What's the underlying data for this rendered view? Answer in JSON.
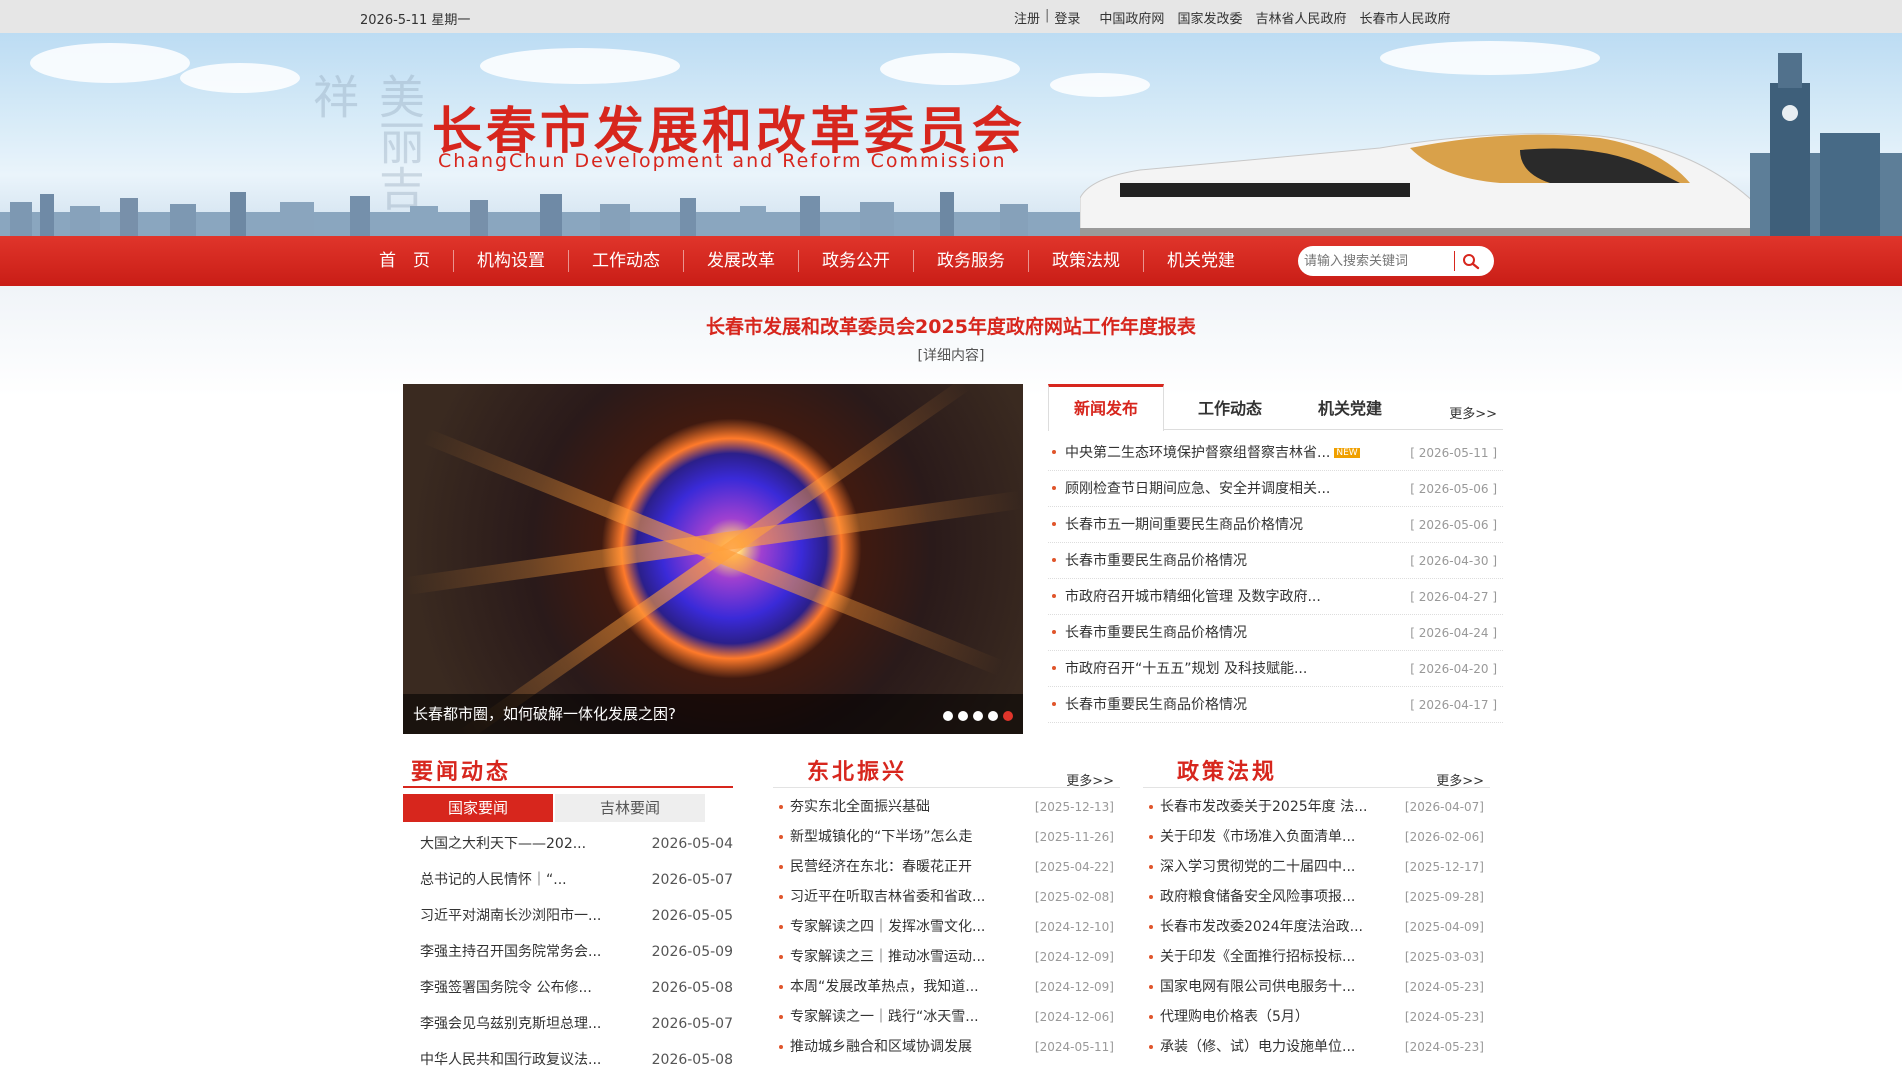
{
  "topbar": {
    "date": "2026-5-11 星期一",
    "register": "注册",
    "login": "登录",
    "links": [
      "中国政府网",
      "国家发改委",
      "吉林省人民政府",
      "长春市人民政府"
    ]
  },
  "banner": {
    "calligraphy": "美丽吉祥",
    "title": "长春市发展和改革委员会",
    "subtitle": "ChangChun Development and Reform Commission"
  },
  "nav": {
    "items": [
      "首　页",
      "机构设置",
      "工作动态",
      "发展改革",
      "政务公开",
      "政务服务",
      "政策法规",
      "机关党建"
    ],
    "search_placeholder": "请输入搜索关键词"
  },
  "notice": {
    "title": "长春市发展和改革委员会2025年度政府网站工作年度报表",
    "more": "[详细内容]"
  },
  "slide": {
    "caption": "长春都市圈，如何破解一体化发展之困?",
    "active_index": 4
  },
  "news": {
    "tabs": [
      "新闻发布",
      "工作动态",
      "机关党建"
    ],
    "more": "更多>>",
    "new_badge": "NEW",
    "items": [
      {
        "title": "中央第二生态环境保护督察组督察吉林省...",
        "date": "[ 2026-05-11 ]"
      },
      {
        "title": "顾刚检查节日期间应急、安全并调度相关...",
        "date": "[ 2026-05-06 ]"
      },
      {
        "title": "长春市五一期间重要民生商品价格情况",
        "date": "[ 2026-05-06 ]"
      },
      {
        "title": "长春市重要民生商品价格情况",
        "date": "[ 2026-04-30 ]"
      },
      {
        "title": "市政府召开城市精细化管理 及数字政府...",
        "date": "[ 2026-04-27 ]"
      },
      {
        "title": "长春市重要民生商品价格情况",
        "date": "[ 2026-04-24 ]"
      },
      {
        "title": "市政府召开“十五五”规划 及科技赋能...",
        "date": "[ 2026-04-20 ]"
      },
      {
        "title": "长春市重要民生商品价格情况",
        "date": "[ 2026-04-17 ]"
      }
    ]
  },
  "yaowen": {
    "heading": "要闻动态",
    "subtabs": [
      "国家要闻",
      "吉林要闻"
    ],
    "items": [
      {
        "title": "大国之大利天下——202...",
        "date": "2026-05-04"
      },
      {
        "title": "总书记的人民情怀｜“...",
        "date": "2026-05-07"
      },
      {
        "title": "习近平对湖南长沙浏阳市一...",
        "date": "2026-05-05"
      },
      {
        "title": "李强主持召开国务院常务会...",
        "date": "2026-05-09"
      },
      {
        "title": "李强签署国务院令 公布修...",
        "date": "2026-05-08"
      },
      {
        "title": "李强会见乌兹别克斯坦总理...",
        "date": "2026-05-07"
      },
      {
        "title": "中华人民共和国行政复议法...",
        "date": "2026-05-08"
      }
    ]
  },
  "dongbei": {
    "heading": "东北振兴",
    "more": "更多>>",
    "items": [
      {
        "title": "夯实东北全面振兴基础",
        "date": "[2025-12-13]"
      },
      {
        "title": "新型城镇化的“下半场”怎么走",
        "date": "[2025-11-26]"
      },
      {
        "title": "民营经济在东北：春暖花正开",
        "date": "[2025-04-22]"
      },
      {
        "title": "习近平在听取吉林省委和省政...",
        "date": "[2025-02-08]"
      },
      {
        "title": "专家解读之四｜发挥冰雪文化...",
        "date": "[2024-12-10]"
      },
      {
        "title": "专家解读之三｜推动冰雪运动...",
        "date": "[2024-12-09]"
      },
      {
        "title": "本周“发展改革热点，我知道...",
        "date": "[2024-12-09]"
      },
      {
        "title": "专家解读之一｜践行“冰天雪...",
        "date": "[2024-12-06]"
      },
      {
        "title": "推动城乡融合和区域协调发展",
        "date": "[2024-05-11]"
      }
    ]
  },
  "zhengce": {
    "heading": "政策法规",
    "more": "更多>>",
    "items": [
      {
        "title": "长春市发改委关于2025年度 法...",
        "date": "[2026-04-07]"
      },
      {
        "title": "关于印发《市场准入负面清单...",
        "date": "[2026-02-06]"
      },
      {
        "title": "深入学习贯彻党的二十届四中...",
        "date": "[2025-12-17]"
      },
      {
        "title": "政府粮食储备安全风险事项报...",
        "date": "[2025-09-28]"
      },
      {
        "title": "长春市发改委2024年度法治政...",
        "date": "[2025-04-09]"
      },
      {
        "title": "关于印发《全面推行招标投标...",
        "date": "[2025-03-03]"
      },
      {
        "title": "国家电网有限公司供电服务十...",
        "date": "[2024-05-23]"
      },
      {
        "title": "代理购电价格表（5月）",
        "date": "[2024-05-23]"
      },
      {
        "title": "承装（修、试）电力设施单位...",
        "date": "[2024-05-23]"
      }
    ]
  }
}
